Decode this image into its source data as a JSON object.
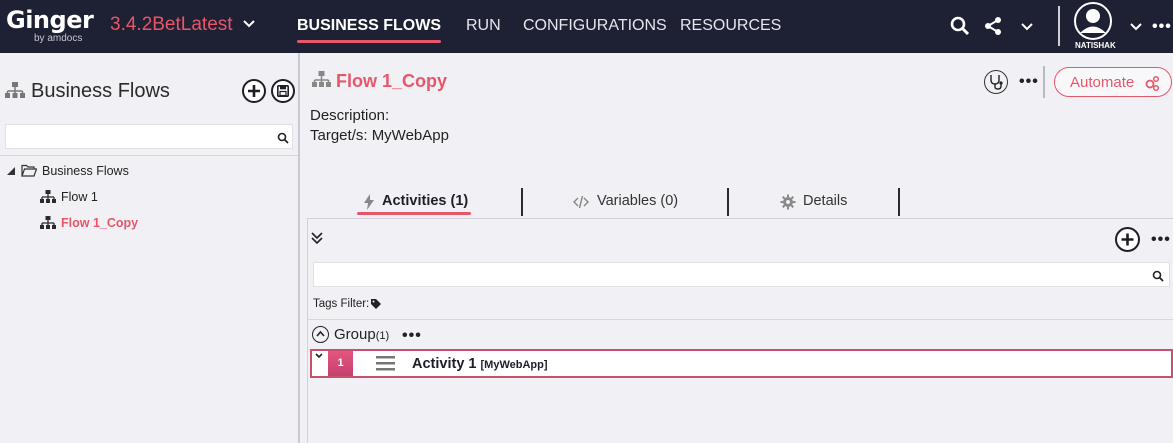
{
  "header": {
    "logo_main": "Ginger",
    "logo_sub": "by amdocs",
    "version": "3.4.2BetLatest",
    "nav": [
      "BUSINESS FLOWS",
      "RUN",
      "CONFIGURATIONS",
      "RESOURCES"
    ],
    "user_name": "NATISHAK",
    "accent_color": "#e8566a",
    "bar_color": "#1e2033"
  },
  "left_panel": {
    "title": "Business Flows",
    "search_value": "",
    "tree": {
      "root": "Business Flows",
      "children": [
        "Flow 1",
        "Flow 1_Copy"
      ],
      "selected": "Flow 1_Copy"
    }
  },
  "business_flow": {
    "name": "Flow 1_Copy",
    "automate_label": "Automate",
    "description_label": "Description:",
    "targets_label": "Target/s: MyWebApp"
  },
  "tabs": [
    {
      "label": "Activities (1)",
      "icon": "bolt-icon",
      "active": true
    },
    {
      "label": "Variables (0)",
      "icon": "code-icon",
      "active": false
    },
    {
      "label": "Details",
      "icon": "gear-icon",
      "active": false
    }
  ],
  "activities": {
    "search_value": "",
    "tags_filter_label": "Tags Filter:",
    "group": {
      "name": "Group",
      "count": "(1)"
    },
    "rows": [
      {
        "index": "1",
        "name": "Activity 1",
        "target": "[MyWebApp]"
      }
    ]
  }
}
